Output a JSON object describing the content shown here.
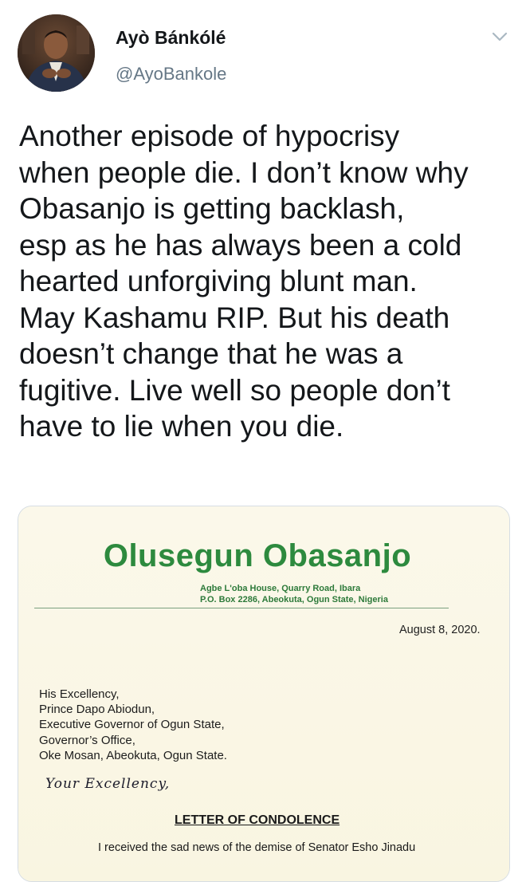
{
  "author": {
    "display_name": "Ayò Bánkólé",
    "handle": "@AyoBankole"
  },
  "icons": {
    "avatar": "profile-photo",
    "menu": "chevron-down-icon"
  },
  "tweet": {
    "text_lines": [
      "Another episode of hypocrisy",
      "when people die. I don’t know why",
      "Obasanjo is getting backlash,",
      "esp as he has always been a cold",
      "hearted unforgiving blunt man.",
      "May Kashamu RIP. But his death",
      "doesn’t change that he was a",
      "fugitive. Live well so people don’t",
      "have to lie when you die."
    ]
  },
  "letter": {
    "letterhead_name": "Olusegun Obasanjo",
    "letterhead_address_1": "Agbe L'oba House, Quarry Road, Ibara",
    "letterhead_address_2": "P.O. Box 2286, Abeokuta, Ogun State, Nigeria",
    "date": "August 8, 2020.",
    "recipient_lines": [
      "His Excellency,",
      "Prince Dapo Abiodun,",
      "Executive Governor of Ogun State,",
      "Governor’s Office,",
      "Oke Mosan, Abeokuta, Ogun State."
    ],
    "salutation": "Your Excellency,",
    "subject": "LETTER OF CONDOLENCE",
    "body_partial": "I received the sad news of the demise of Senator Esho Jinadu"
  },
  "colors": {
    "text": "#14171a",
    "secondary": "#657786",
    "letterhead_green": "#2d8a3e",
    "paper": "#fbf8ea"
  }
}
